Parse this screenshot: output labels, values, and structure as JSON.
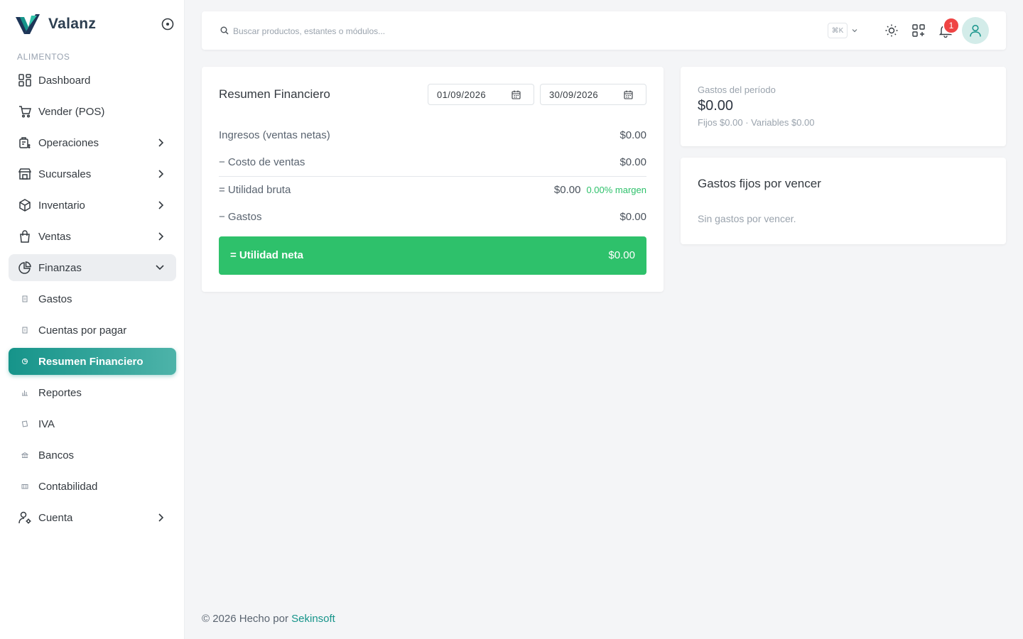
{
  "brand": {
    "name": "Valanz"
  },
  "sidebar": {
    "section": "ALIMENTOS",
    "items": [
      {
        "label": "Dashboard",
        "icon": "dashboard-icon"
      },
      {
        "label": "Vender (POS)",
        "icon": "cart-icon"
      },
      {
        "label": "Operaciones",
        "icon": "operations-icon"
      },
      {
        "label": "Sucursales",
        "icon": "store-icon"
      },
      {
        "label": "Inventario",
        "icon": "box-icon"
      },
      {
        "label": "Ventas",
        "icon": "shopping-bag-icon"
      },
      {
        "label": "Finanzas",
        "icon": "pie-chart-icon"
      }
    ],
    "sub_items": [
      {
        "label": "Gastos"
      },
      {
        "label": "Cuentas por pagar"
      },
      {
        "label": "Resumen Financiero"
      },
      {
        "label": "Reportes"
      },
      {
        "label": "IVA"
      },
      {
        "label": "Bancos"
      },
      {
        "label": "Contabilidad"
      }
    ],
    "account": {
      "label": "Cuenta",
      "icon": "user-settings-icon"
    }
  },
  "topbar": {
    "search_placeholder": "Buscar productos, estantes o módulos...",
    "shortcut": "⌘K",
    "notification_count": "1"
  },
  "finance": {
    "title": "Resumen Financiero",
    "date_from": "01/09/2026",
    "date_to": "30/09/2026",
    "rows": [
      {
        "label": "Ingresos (ventas netas)",
        "value": "$0.00"
      },
      {
        "label": "− Costo de ventas",
        "value": "$0.00"
      },
      {
        "label": "= Utilidad bruta",
        "value": "$0.00",
        "margin": "0.00% margen"
      },
      {
        "label": "− Gastos",
        "value": "$0.00"
      }
    ],
    "net": {
      "label": "= Utilidad neta",
      "value": "$0.00"
    },
    "accent_color": "#2ec16b"
  },
  "period_expenses": {
    "label": "Gastos del período",
    "value": "$0.00",
    "detail": "Fijos $0.00 · Variables $0.00"
  },
  "fixed_expenses": {
    "title": "Gastos fijos por vencer",
    "empty": "Sin gastos por vencer."
  },
  "footer": {
    "text": "© 2026 Hecho por ",
    "link": "Sekinsoft"
  },
  "colors": {
    "brand": "#16948a",
    "active_gradient_end": "#4db3a9",
    "badge": "#ef4444"
  }
}
